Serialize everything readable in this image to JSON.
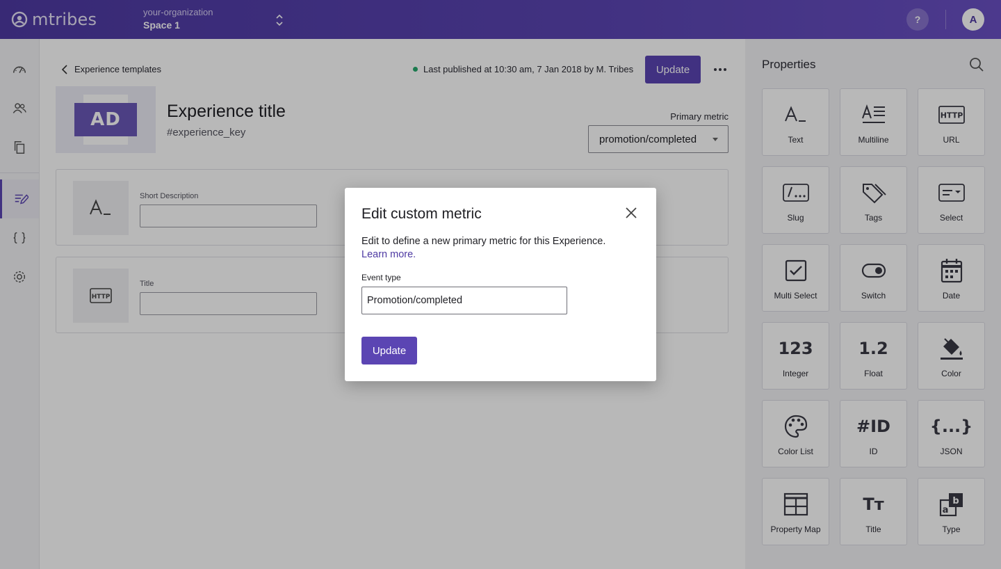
{
  "app": {
    "logo_text": "mtribes"
  },
  "header": {
    "organization": "your-organization",
    "space": "Space 1",
    "help_label": "?",
    "avatar_initial": "A"
  },
  "nav": {
    "items": [
      {
        "icon": "dashboard-icon"
      },
      {
        "icon": "users-icon"
      },
      {
        "icon": "copy-icon"
      },
      {
        "icon": "experiences-edit-icon",
        "active": true
      },
      {
        "icon": "braces-icon"
      },
      {
        "icon": "settings-gear-icon"
      }
    ]
  },
  "main": {
    "back_label": "Experience templates",
    "publish_status": "Last published at 10:30 am, 7 Jan 2018 by M. Tribes",
    "update_label": "Update",
    "thumbnail_text": "AD",
    "title": "Experience title",
    "key": "#experience_key",
    "primary_metric_label": "Primary metric",
    "primary_metric_value": "promotion/completed",
    "fields": [
      {
        "icon": "text-icon",
        "label": "Short Description",
        "value": ""
      },
      {
        "icon": "http-icon",
        "label": "Title",
        "value": ""
      }
    ]
  },
  "panel": {
    "title": "Properties",
    "tiles": [
      {
        "label": "Text",
        "icon": "text-icon"
      },
      {
        "label": "Multiline",
        "icon": "multiline-icon"
      },
      {
        "label": "URL",
        "icon": "http-icon"
      },
      {
        "label": "Slug",
        "icon": "slug-icon"
      },
      {
        "label": "Tags",
        "icon": "tags-icon"
      },
      {
        "label": "Select",
        "icon": "select-icon"
      },
      {
        "label": "Multi Select",
        "icon": "checkbox-icon"
      },
      {
        "label": "Switch",
        "icon": "switch-icon"
      },
      {
        "label": "Date",
        "icon": "calendar-icon"
      },
      {
        "label": "Integer",
        "icon": "integer-icon",
        "glyph": "123"
      },
      {
        "label": "Float",
        "icon": "float-icon",
        "glyph": "1.2"
      },
      {
        "label": "Color",
        "icon": "paint-bucket-icon"
      },
      {
        "label": "Color List",
        "icon": "palette-icon"
      },
      {
        "label": "ID",
        "icon": "id-icon",
        "glyph": "#ID"
      },
      {
        "label": "JSON",
        "icon": "json-icon",
        "glyph": "{...}"
      },
      {
        "label": "Property Map",
        "icon": "table-icon"
      },
      {
        "label": "Title",
        "icon": "title-icon",
        "glyph": "Tт"
      },
      {
        "label": "Type",
        "icon": "type-icon"
      }
    ]
  },
  "modal": {
    "title": "Edit custom metric",
    "description": "Edit to define a new primary metric for this Experience.",
    "link": "Learn more.",
    "field_label": "Event type",
    "field_value": "Promotion/completed",
    "submit_label": "Update"
  },
  "colors": {
    "brand": "#5b45b3",
    "status_dot": "#26a96c"
  }
}
